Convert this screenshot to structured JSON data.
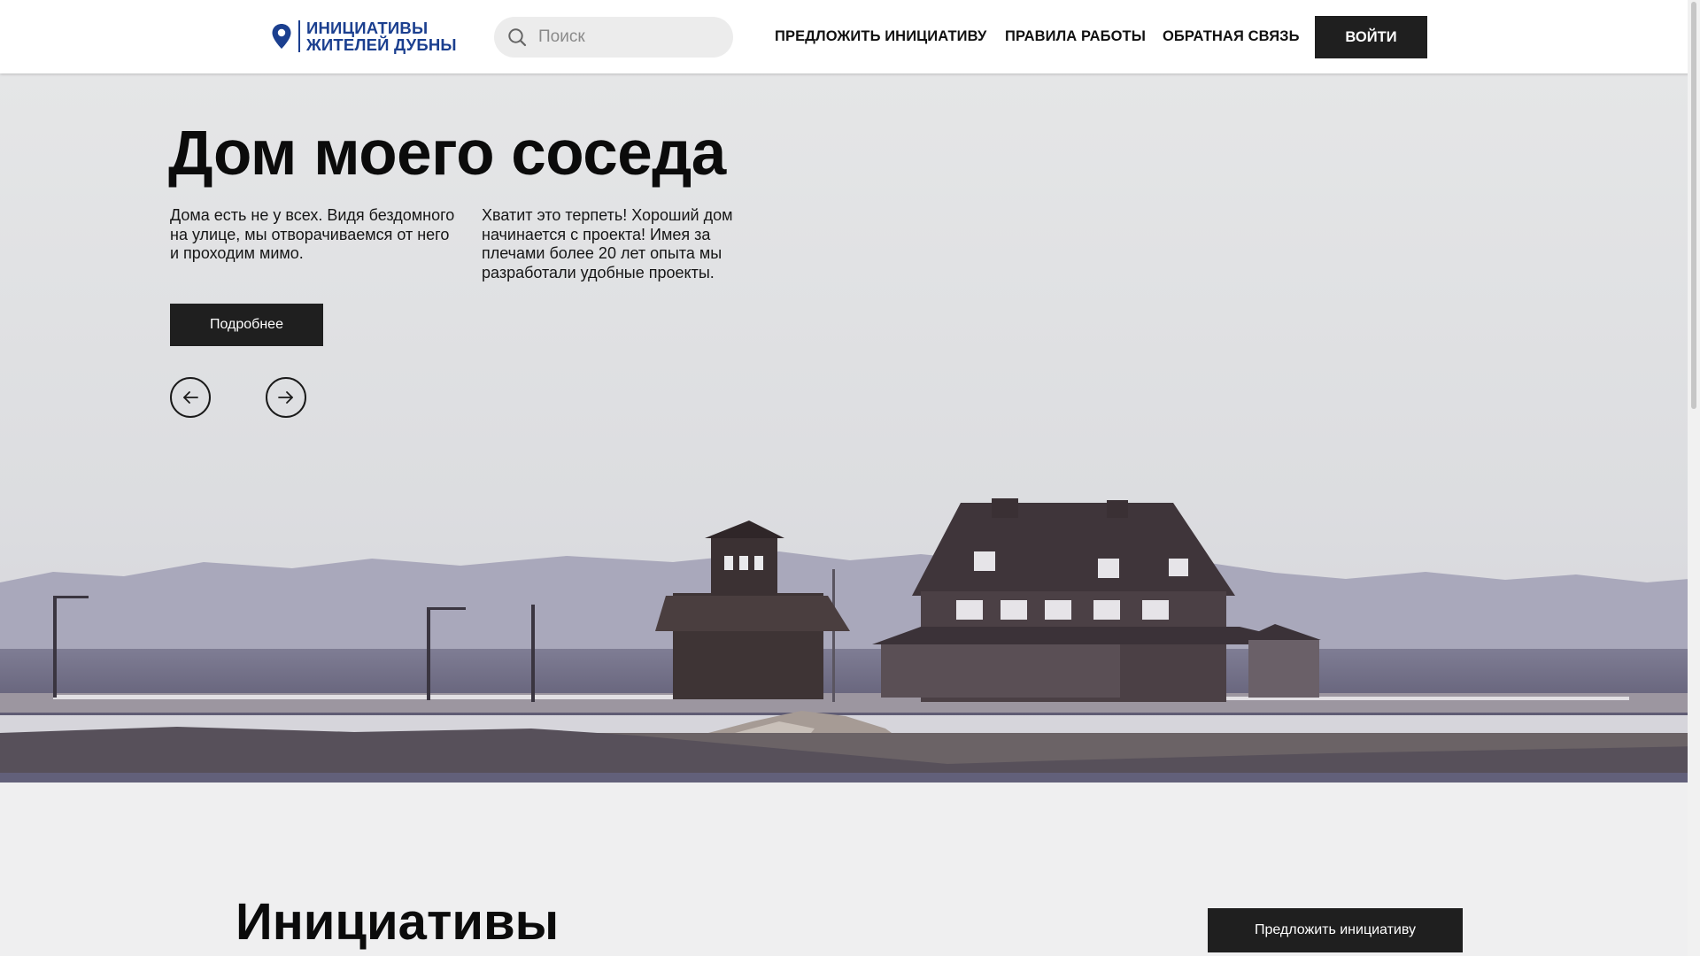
{
  "header": {
    "logo_line1": "ИНИЦИАТИВЫ",
    "logo_line2": "ЖИТЕЛЕЙ ДУБНЫ",
    "logo_icon": "map-pin-icon",
    "search_placeholder": "Поиск",
    "search_icon": "search-icon",
    "nav": {
      "propose": "ПРЕДЛОЖИТЬ ИНИЦИАТИВУ",
      "rules": "ПРАВИЛА РАБОТЫ",
      "feedback": "ОБРАТНАЯ СВЯЗЬ"
    },
    "login_label": "ВОЙТИ"
  },
  "hero": {
    "title": "Дом моего соседа",
    "text_left": "Дома есть не у всех. Видя бездомного на улице, мы отворачиваемся от него и проходим мимо.",
    "text_right": "Хватит это терпеть! Хороший дом начинается с проекта! Имея за плечами более 20 лет опыта мы разработали удобные проекты.",
    "more_label": "Подробнее",
    "prev_icon": "arrow-left-icon",
    "next_icon": "arrow-right-icon"
  },
  "initiatives": {
    "title": "Инициативы",
    "propose_label": "Предложить инициативу"
  },
  "colors": {
    "brand_blue": "#1b3f8f",
    "button_dark": "#1f1f1f",
    "page_bg": "#efeff0"
  }
}
